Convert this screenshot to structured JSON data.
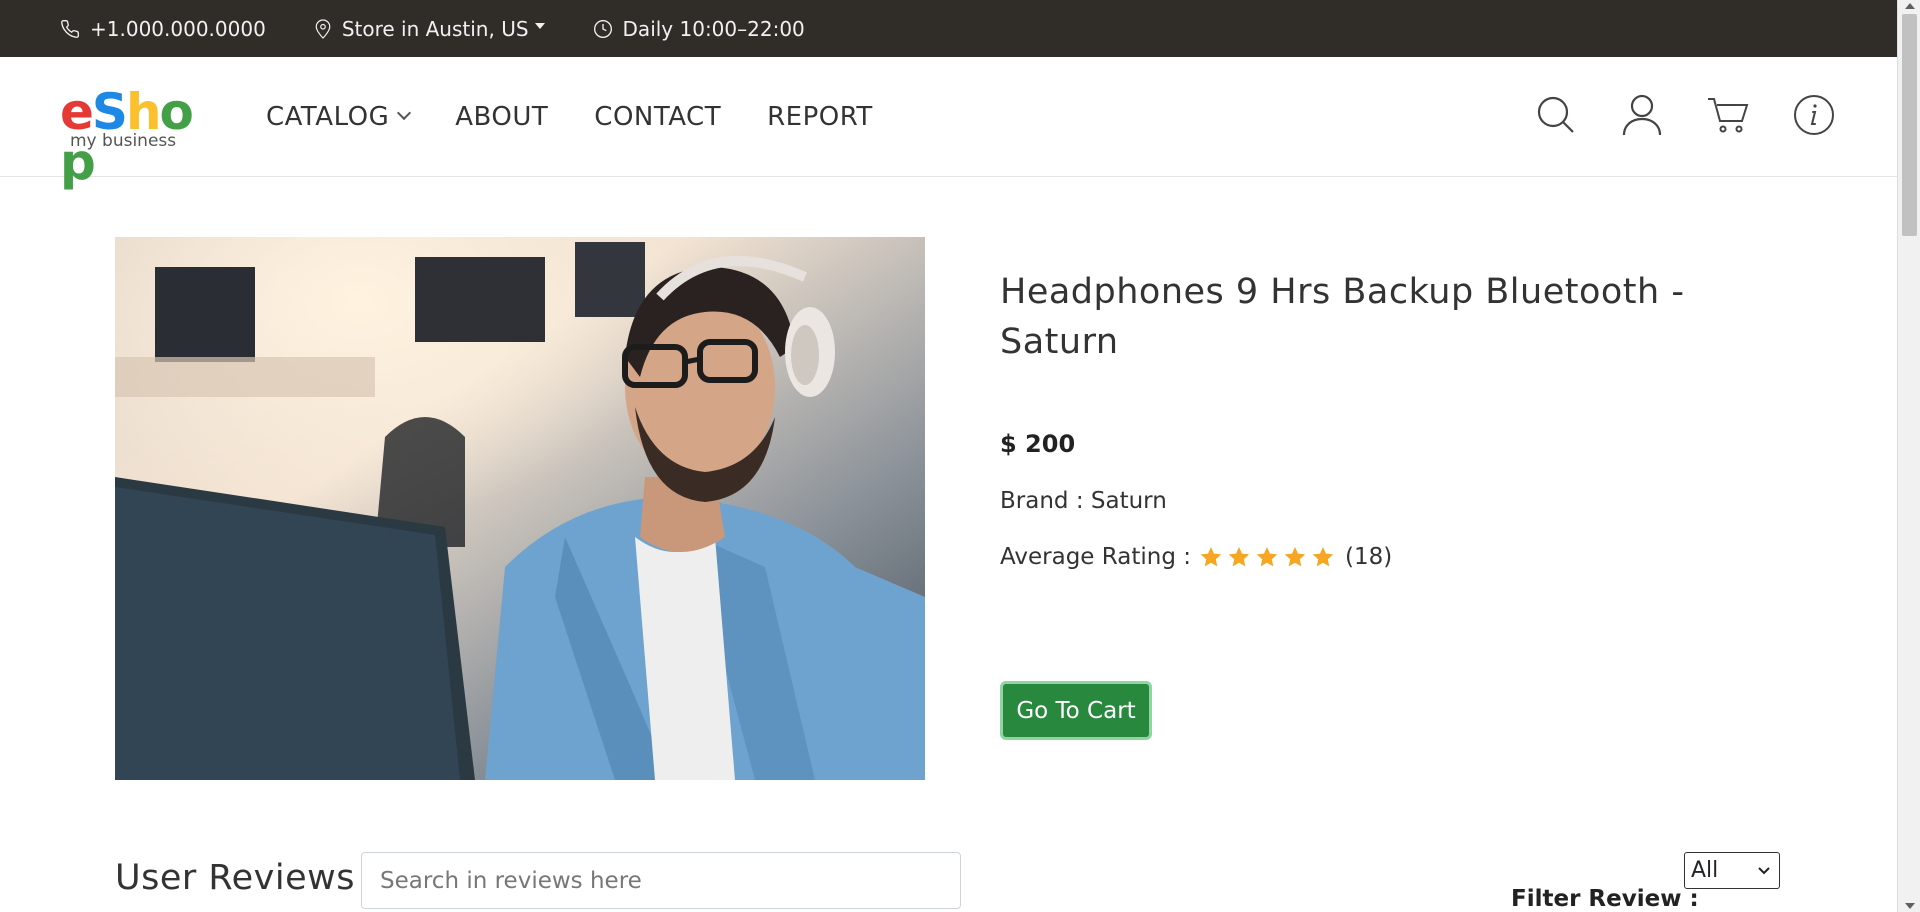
{
  "topbar": {
    "phone": "+1.000.000.0000",
    "store": "Store in Austin, US",
    "hours": "Daily 10:00–22:00"
  },
  "logo": {
    "letters": [
      "e",
      "S",
      "h",
      "o",
      "p"
    ],
    "letter_colors": [
      "#e53935",
      "#1e88e5",
      "#fbc02d",
      "#43a047",
      "#43a047"
    ],
    "tagline": "my business"
  },
  "nav": {
    "items": [
      {
        "label": "CATALOG",
        "has_dropdown": true
      },
      {
        "label": "ABOUT"
      },
      {
        "label": "CONTACT"
      },
      {
        "label": "REPORT"
      }
    ]
  },
  "header_icons": [
    "search-icon",
    "user-icon",
    "cart-icon",
    "info-icon"
  ],
  "product": {
    "title": "Headphones 9 Hrs Backup Bluetooth - Saturn",
    "price": "$ 200",
    "brand_label": "Brand : Saturn",
    "rating_label": "Average Rating :",
    "rating_value": 5,
    "rating_count": "(18)",
    "star_color": "#f5a623",
    "cart_button": "Go To Cart"
  },
  "reviews": {
    "title": "User Reviews",
    "search_placeholder": "Search in reviews here",
    "filter_label": "Filter Review :",
    "filter_value": "All"
  },
  "colors": {
    "topbar_bg": "#302c28",
    "cart_button_bg": "#28893e"
  }
}
